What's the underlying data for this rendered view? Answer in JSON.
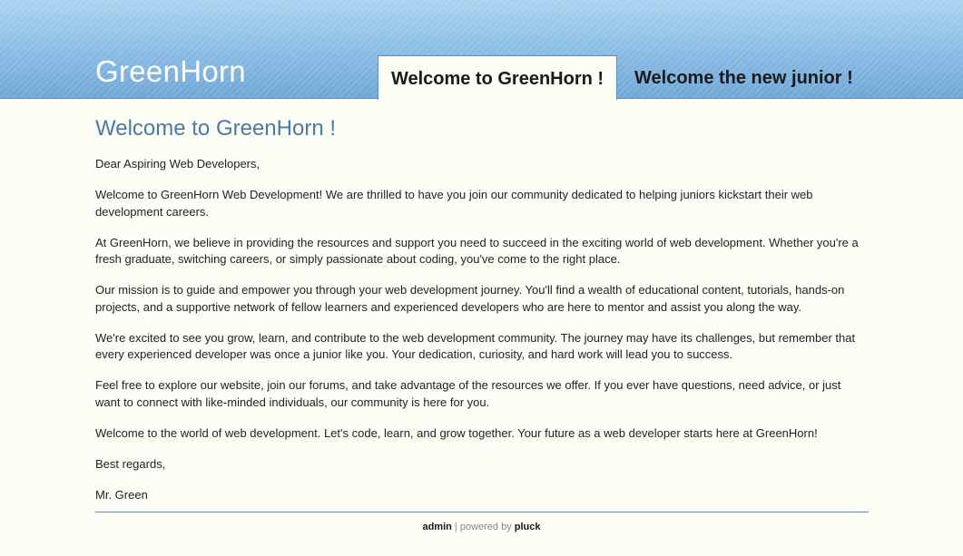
{
  "header": {
    "site_title": "GreenHorn",
    "tabs": [
      {
        "label": "Welcome to GreenHorn !",
        "active": true
      },
      {
        "label": "Welcome the new junior !",
        "active": false
      }
    ]
  },
  "main": {
    "heading": "Welcome to GreenHorn !",
    "paragraphs": [
      "Dear Aspiring Web Developers,",
      "Welcome to GreenHorn Web Development! We are thrilled to have you join our community dedicated to helping juniors kickstart their web development careers.",
      "At GreenHorn, we believe in providing the resources and support you need to succeed in the exciting world of web development. Whether you're a fresh graduate, switching careers, or simply passionate about coding, you've come to the right place.",
      "Our mission is to guide and empower you through your web development journey. You'll find a wealth of educational content, tutorials, hands-on projects, and a supportive network of fellow learners and experienced developers who are here to mentor and assist you along the way.",
      "We're excited to see you grow, learn, and contribute to the web development community. The journey may have its challenges, but remember that every experienced developer was once a junior like you. Your dedication, curiosity, and hard work will lead you to success.",
      "Feel free to explore our website, join our forums, and take advantage of the resources we offer. If you ever have questions, need advice, or just want to connect with like-minded individuals, our community is here for you.",
      "Welcome to the world of web development. Let's code, learn, and grow together. Your future as a web developer starts here at GreenHorn!",
      "Best regards,",
      "Mr. Green"
    ]
  },
  "footer": {
    "admin_link": "admin",
    "separator_text": " | powered by ",
    "pluck_link": "pluck"
  },
  "colors": {
    "header_blue": "#8dbfe6",
    "heading_blue": "#4b7aa6",
    "page_background": "#fcfdf4",
    "rule_blue": "#5a8ec0"
  }
}
